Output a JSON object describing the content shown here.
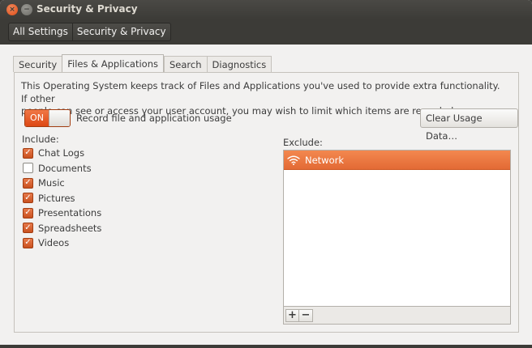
{
  "window": {
    "title": "Security & Privacy",
    "close_icon": "×",
    "minimize_icon": "−"
  },
  "breadcrumb": {
    "items": [
      "All Settings",
      "Security & Privacy"
    ]
  },
  "tabs": [
    {
      "label": "Security",
      "active": false
    },
    {
      "label": "Files & Applications",
      "active": true
    },
    {
      "label": "Search",
      "active": false
    },
    {
      "label": "Diagnostics",
      "active": false
    }
  ],
  "panel": {
    "description_line1": "This Operating System keeps track of Files and Applications you've used to provide extra functionality. If other",
    "description_line2": "people can see or access your user account, you may wish to limit which items are recorded.",
    "record_switch": {
      "state": "ON",
      "on": true
    },
    "record_label": "Record file and application usage",
    "clear_button": "Clear Usage Data…",
    "include_label": "Include:",
    "include_items": [
      {
        "label": "Chat Logs",
        "checked": true
      },
      {
        "label": "Documents",
        "checked": false
      },
      {
        "label": "Music",
        "checked": true
      },
      {
        "label": "Pictures",
        "checked": true
      },
      {
        "label": "Presentations",
        "checked": true
      },
      {
        "label": "Spreadsheets",
        "checked": true
      },
      {
        "label": "Videos",
        "checked": true
      }
    ],
    "exclude_label": "Exclude:",
    "exclude_items": [
      {
        "label": "Network",
        "icon": "wifi-icon",
        "selected": true
      }
    ],
    "add_button": "+",
    "remove_button": "−"
  },
  "colors": {
    "accent": "#dd4814",
    "titlebar": "#3c3b37",
    "window_bg": "#f2f1f0"
  }
}
